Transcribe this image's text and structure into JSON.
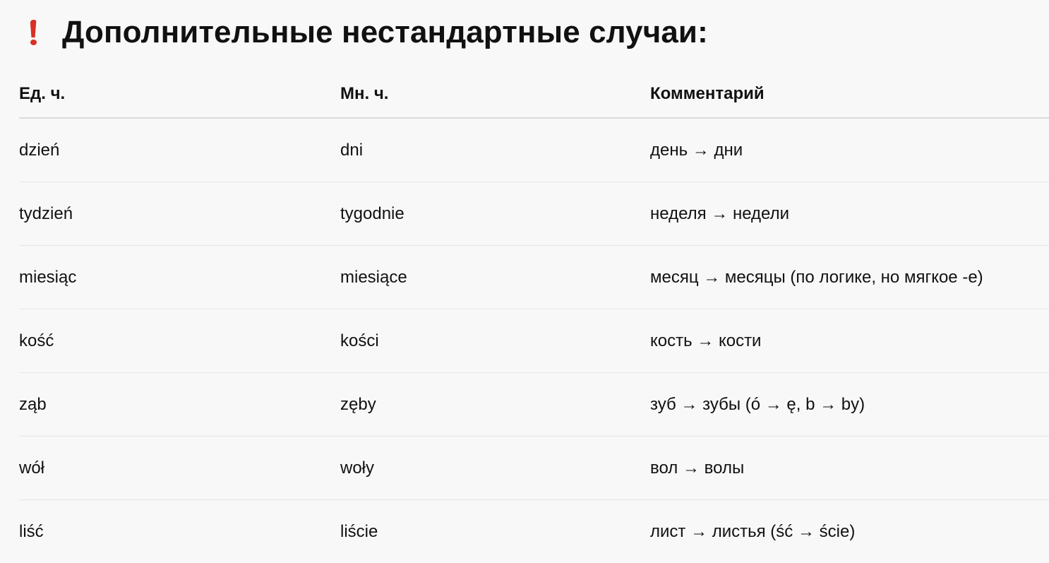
{
  "heading": {
    "icon": "exclamation-icon",
    "icon_color": "#d93025",
    "title": "Дополнительные нестандартные случаи:"
  },
  "table": {
    "headers": [
      "Ед. ч.",
      "Мн. ч.",
      "Комментарий"
    ],
    "rows": [
      [
        "dzień",
        "dni",
        "день → дни"
      ],
      [
        "tydzień",
        "tygodnie",
        "неделя → недели"
      ],
      [
        "miesiąc",
        "miesiące",
        "месяц → месяцы (по логике, но мягкое -е)"
      ],
      [
        "kość",
        "kości",
        "кость → кости"
      ],
      [
        "ząb",
        "zęby",
        "зуб → зубы (ó → ę, b → by)"
      ],
      [
        "wół",
        "woły",
        "вол → волы"
      ],
      [
        "liść",
        "liście",
        "лист → листья (ść → ście)"
      ]
    ]
  }
}
